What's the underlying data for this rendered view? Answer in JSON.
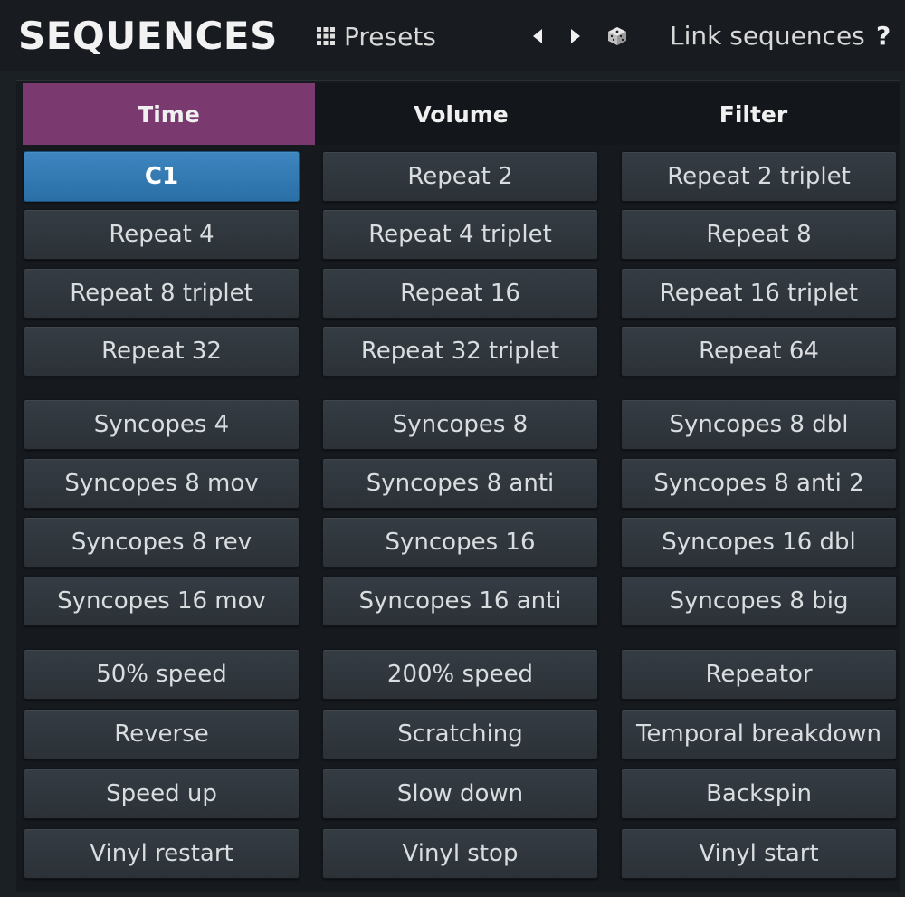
{
  "header": {
    "title": "SEQUENCES",
    "presets_label": "Presets",
    "link_label": "Link sequences",
    "help_label": "?",
    "icons": [
      "grid-icon",
      "arrow-left-icon",
      "arrow-right-icon",
      "dice-icon"
    ]
  },
  "tabs": [
    {
      "label": "Time",
      "active": true
    },
    {
      "label": "Volume",
      "active": false
    },
    {
      "label": "Filter",
      "active": false
    }
  ],
  "buttons": [
    "C1",
    "Repeat 2",
    "Repeat 2 triplet",
    "Repeat 4",
    "Repeat 4 triplet",
    "Repeat 8",
    "Repeat 8 triplet",
    "Repeat 16",
    "Repeat 16 triplet",
    "Repeat 32",
    "Repeat 32 triplet",
    "Repeat 64",
    "Syncopes 4",
    "Syncopes 8",
    "Syncopes 8 dbl",
    "Syncopes 8 mov",
    "Syncopes 8 anti",
    "Syncopes 8 anti 2",
    "Syncopes 8 rev",
    "Syncopes 16",
    "Syncopes 16 dbl",
    "Syncopes 16 mov",
    "Syncopes 16 anti",
    "Syncopes 8 big",
    "50% speed",
    "200% speed",
    "Repeator",
    "Reverse",
    "Scratching",
    "Temporal breakdown",
    "Speed up",
    "Slow down",
    "Backspin",
    "Vinyl restart",
    "Vinyl stop",
    "Vinyl start"
  ],
  "selected_button": "C1",
  "colors": {
    "background": "#1b2025",
    "active_tab": "#7a3a70",
    "selected_button": "#3079b4",
    "button": "#30363c",
    "text": "#d9dde0"
  }
}
